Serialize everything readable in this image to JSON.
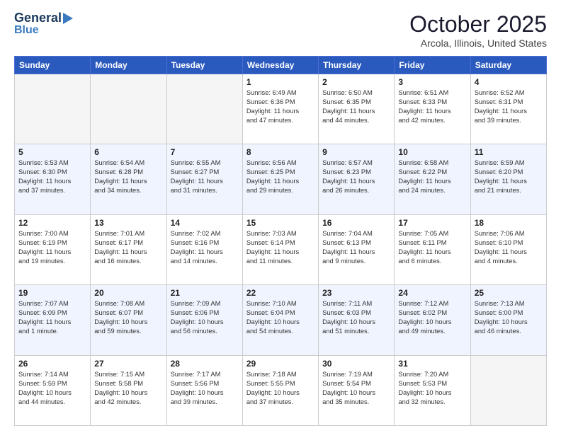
{
  "header": {
    "logo_line1": "General",
    "logo_line2": "Blue",
    "month": "October 2025",
    "location": "Arcola, Illinois, United States"
  },
  "days_of_week": [
    "Sunday",
    "Monday",
    "Tuesday",
    "Wednesday",
    "Thursday",
    "Friday",
    "Saturday"
  ],
  "weeks": [
    [
      {
        "day": "",
        "info": ""
      },
      {
        "day": "",
        "info": ""
      },
      {
        "day": "",
        "info": ""
      },
      {
        "day": "1",
        "info": "Sunrise: 6:49 AM\nSunset: 6:36 PM\nDaylight: 11 hours\nand 47 minutes."
      },
      {
        "day": "2",
        "info": "Sunrise: 6:50 AM\nSunset: 6:35 PM\nDaylight: 11 hours\nand 44 minutes."
      },
      {
        "day": "3",
        "info": "Sunrise: 6:51 AM\nSunset: 6:33 PM\nDaylight: 11 hours\nand 42 minutes."
      },
      {
        "day": "4",
        "info": "Sunrise: 6:52 AM\nSunset: 6:31 PM\nDaylight: 11 hours\nand 39 minutes."
      }
    ],
    [
      {
        "day": "5",
        "info": "Sunrise: 6:53 AM\nSunset: 6:30 PM\nDaylight: 11 hours\nand 37 minutes."
      },
      {
        "day": "6",
        "info": "Sunrise: 6:54 AM\nSunset: 6:28 PM\nDaylight: 11 hours\nand 34 minutes."
      },
      {
        "day": "7",
        "info": "Sunrise: 6:55 AM\nSunset: 6:27 PM\nDaylight: 11 hours\nand 31 minutes."
      },
      {
        "day": "8",
        "info": "Sunrise: 6:56 AM\nSunset: 6:25 PM\nDaylight: 11 hours\nand 29 minutes."
      },
      {
        "day": "9",
        "info": "Sunrise: 6:57 AM\nSunset: 6:23 PM\nDaylight: 11 hours\nand 26 minutes."
      },
      {
        "day": "10",
        "info": "Sunrise: 6:58 AM\nSunset: 6:22 PM\nDaylight: 11 hours\nand 24 minutes."
      },
      {
        "day": "11",
        "info": "Sunrise: 6:59 AM\nSunset: 6:20 PM\nDaylight: 11 hours\nand 21 minutes."
      }
    ],
    [
      {
        "day": "12",
        "info": "Sunrise: 7:00 AM\nSunset: 6:19 PM\nDaylight: 11 hours\nand 19 minutes."
      },
      {
        "day": "13",
        "info": "Sunrise: 7:01 AM\nSunset: 6:17 PM\nDaylight: 11 hours\nand 16 minutes."
      },
      {
        "day": "14",
        "info": "Sunrise: 7:02 AM\nSunset: 6:16 PM\nDaylight: 11 hours\nand 14 minutes."
      },
      {
        "day": "15",
        "info": "Sunrise: 7:03 AM\nSunset: 6:14 PM\nDaylight: 11 hours\nand 11 minutes."
      },
      {
        "day": "16",
        "info": "Sunrise: 7:04 AM\nSunset: 6:13 PM\nDaylight: 11 hours\nand 9 minutes."
      },
      {
        "day": "17",
        "info": "Sunrise: 7:05 AM\nSunset: 6:11 PM\nDaylight: 11 hours\nand 6 minutes."
      },
      {
        "day": "18",
        "info": "Sunrise: 7:06 AM\nSunset: 6:10 PM\nDaylight: 11 hours\nand 4 minutes."
      }
    ],
    [
      {
        "day": "19",
        "info": "Sunrise: 7:07 AM\nSunset: 6:09 PM\nDaylight: 11 hours\nand 1 minute."
      },
      {
        "day": "20",
        "info": "Sunrise: 7:08 AM\nSunset: 6:07 PM\nDaylight: 10 hours\nand 59 minutes."
      },
      {
        "day": "21",
        "info": "Sunrise: 7:09 AM\nSunset: 6:06 PM\nDaylight: 10 hours\nand 56 minutes."
      },
      {
        "day": "22",
        "info": "Sunrise: 7:10 AM\nSunset: 6:04 PM\nDaylight: 10 hours\nand 54 minutes."
      },
      {
        "day": "23",
        "info": "Sunrise: 7:11 AM\nSunset: 6:03 PM\nDaylight: 10 hours\nand 51 minutes."
      },
      {
        "day": "24",
        "info": "Sunrise: 7:12 AM\nSunset: 6:02 PM\nDaylight: 10 hours\nand 49 minutes."
      },
      {
        "day": "25",
        "info": "Sunrise: 7:13 AM\nSunset: 6:00 PM\nDaylight: 10 hours\nand 46 minutes."
      }
    ],
    [
      {
        "day": "26",
        "info": "Sunrise: 7:14 AM\nSunset: 5:59 PM\nDaylight: 10 hours\nand 44 minutes."
      },
      {
        "day": "27",
        "info": "Sunrise: 7:15 AM\nSunset: 5:58 PM\nDaylight: 10 hours\nand 42 minutes."
      },
      {
        "day": "28",
        "info": "Sunrise: 7:17 AM\nSunset: 5:56 PM\nDaylight: 10 hours\nand 39 minutes."
      },
      {
        "day": "29",
        "info": "Sunrise: 7:18 AM\nSunset: 5:55 PM\nDaylight: 10 hours\nand 37 minutes."
      },
      {
        "day": "30",
        "info": "Sunrise: 7:19 AM\nSunset: 5:54 PM\nDaylight: 10 hours\nand 35 minutes."
      },
      {
        "day": "31",
        "info": "Sunrise: 7:20 AM\nSunset: 5:53 PM\nDaylight: 10 hours\nand 32 minutes."
      },
      {
        "day": "",
        "info": ""
      }
    ]
  ]
}
